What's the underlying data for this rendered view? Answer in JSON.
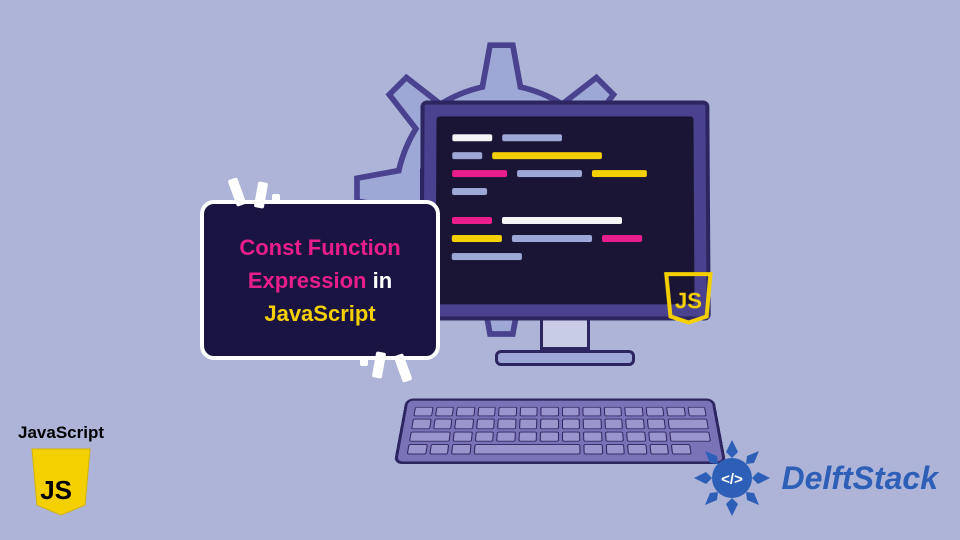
{
  "title_card": {
    "line1a": "Const Function",
    "line2a": "Expression",
    "line2b": " in",
    "line3a": "JavaScript"
  },
  "js_logo": {
    "label": "JavaScript",
    "badge_text": "JS"
  },
  "monitor_badge": "JS",
  "delftstack": {
    "text": "DelftStack",
    "glyph": "</>"
  },
  "colors": {
    "bg": "#adb4d7",
    "card_bg": "#1a1442",
    "pink": "#e91e8c",
    "yellow": "#f5d000",
    "blue_brand": "#2e5fb7"
  }
}
